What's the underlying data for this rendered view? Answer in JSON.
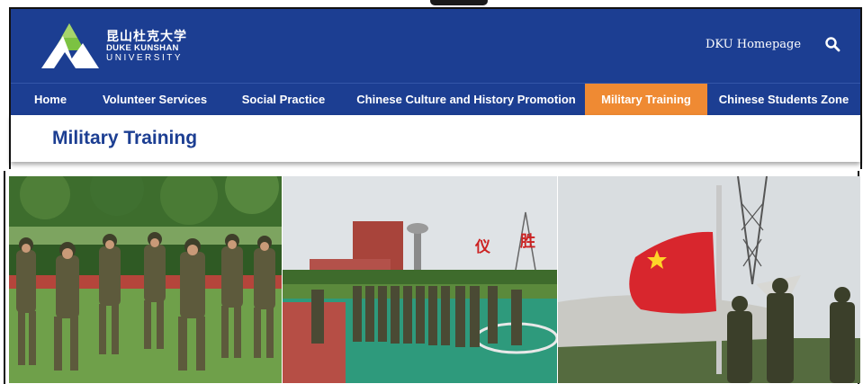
{
  "header": {
    "logo_cn": "昆山杜克大学",
    "logo_en_line1": "DUKE KUNSHAN",
    "logo_en_line2": "UNIVERSITY",
    "homepage_link": "DKU Homepage"
  },
  "nav": {
    "items": [
      {
        "label": "Home"
      },
      {
        "label": "Volunteer Services"
      },
      {
        "label": "Social Practice"
      },
      {
        "label": "Chinese Culture and History Promotion"
      },
      {
        "label": "Military Training",
        "active": true
      },
      {
        "label": "Chinese Students Zone"
      }
    ]
  },
  "page": {
    "title": "Military Training"
  },
  "photos": {
    "sign_chars": [
      "仪",
      "胜"
    ]
  },
  "colors": {
    "header_blue": "#1c3e92",
    "active_orange": "#ef8a33",
    "flag_red": "#d8262d"
  }
}
